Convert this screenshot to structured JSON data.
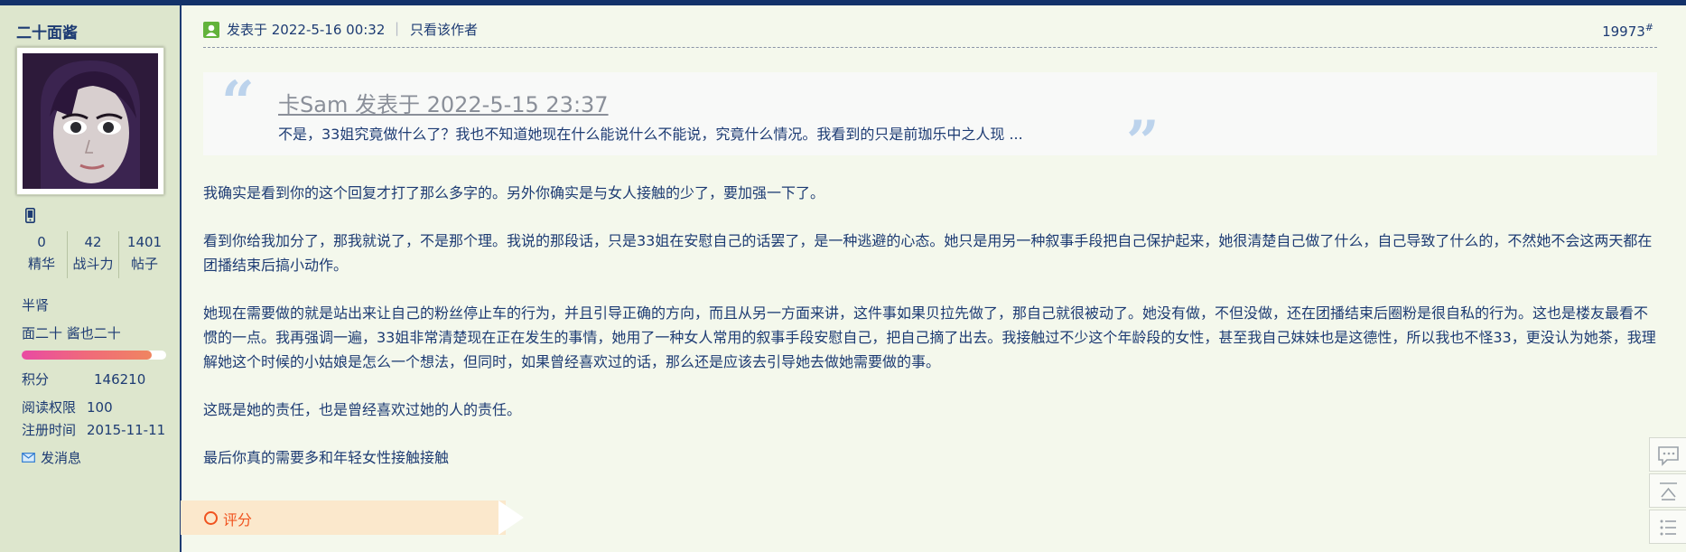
{
  "profile": {
    "username": "二十面酱",
    "stats": [
      {
        "value": "0",
        "label": "精华"
      },
      {
        "value": "42",
        "label": "战斗力"
      },
      {
        "value": "1401",
        "label": "帖子"
      }
    ],
    "rank": "半肾",
    "group": "面二十 酱也二十",
    "exp_progress": 0.9,
    "points_label": "积分",
    "points_value": "146210",
    "read_perm_label": "阅读权限",
    "read_perm_value": "100",
    "reg_label": "注册时间",
    "reg_value": "2015-11-11",
    "pm_label": "发消息"
  },
  "post": {
    "posted_at": "发表于 2022-5-16 00:32",
    "separator": "|",
    "only_author": "只看该作者",
    "floor_number": "19973",
    "floor_suffix": "#",
    "quote": {
      "header": "卡Sam 发表于 2022-5-15 23:37",
      "body": "不是，33姐究竟做什么了？我也不知道她现在什么能说什么不能说，究竟什么情况。我看到的只是前珈乐中之人现 ..."
    },
    "paragraphs": [
      "我确实是看到你的这个回复才打了那么多字的。另外你确实是与女人接触的少了，要加强一下了。",
      "看到你给我加分了，那我就说了，不是那个理。我说的那段话，只是33姐在安慰自己的话罢了，是一种逃避的心态。她只是用另一种叙事手段把自己保护起来，她很清楚自己做了什么，自己导致了什么的，不然她不会这两天都在团播结束后搞小动作。",
      "她现在需要做的就是站出来让自己的粉丝停止车的行为，并且引导正确的方向，而且从另一方面来讲，这件事如果贝拉先做了，那自己就很被动了。她没有做，不但没做，还在团播结束后圈粉是很自私的行为。这也是楼友最看不惯的一点。我再强调一遍，33姐非常清楚现在正在发生的事情，她用了一种女人常用的叙事手段安慰自己，把自己摘了出去。我接触过不少这个年龄段的女性，甚至我自己妹妹也是这德性，所以我也不怪33，更没认为她茶，我理解她这个时候的小姑娘是怎么一个想法，但同时，如果曾经喜欢过的话，那么还是应该去引导她去做她需要做的事。",
      "这既是她的责任，也是曾经喜欢过她的人的责任。",
      "最后你真的需要多和年轻女性接触接触"
    ],
    "rate_label": "评分"
  },
  "icons": {
    "phone": "mobile-phone-icon",
    "user": "user-icon",
    "mail": "mail-icon",
    "rate": "circle-icon",
    "float": [
      "reply-bubble-icon",
      "back-to-top-icon",
      "list-icon"
    ]
  },
  "colors": {
    "text": "#1d3b73",
    "sidebar_bg": "#dde6cd",
    "page_bg": "#f4f8ec",
    "rate_accent": "#f0531f",
    "user_icon": "#62b33b"
  }
}
